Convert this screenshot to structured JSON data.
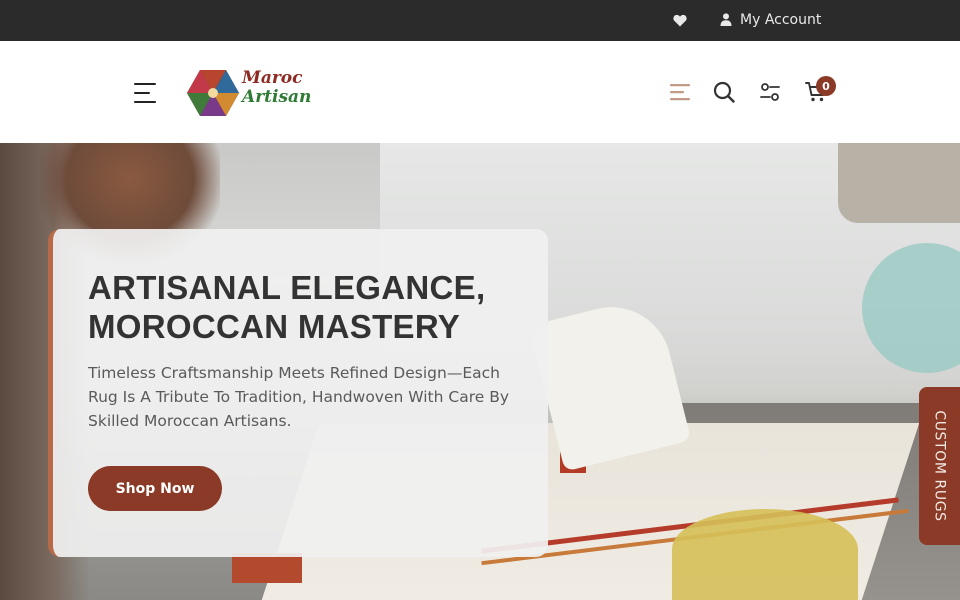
{
  "topbar": {
    "wishlist_icon": "heart-icon",
    "account_icon": "user-icon",
    "account_label": "My Account"
  },
  "header": {
    "menu_icon": "hamburger-icon",
    "logo": {
      "line1": "Maroc",
      "line2": "Artisan"
    },
    "icons": [
      "menu-lines-icon",
      "search-icon",
      "compare-icon",
      "cart-icon"
    ],
    "cart_count": "0"
  },
  "hero": {
    "title": "ARTISANAL ELEGANCE, MOROCCAN MASTERY",
    "subtitle": "Timeless Craftsmanship Meets Refined Design—Each Rug Is A Tribute To Tradition, Handwoven With Care By Skilled Moroccan Artisans.",
    "cta_label": "Shop Now"
  },
  "side_tab": {
    "label": "CUSTOM RUGS"
  },
  "colors": {
    "topbar_bg": "#2b2b2b",
    "accent": "#8a3a26",
    "card_bg": "#f0f0f0",
    "title_text": "#333333"
  }
}
